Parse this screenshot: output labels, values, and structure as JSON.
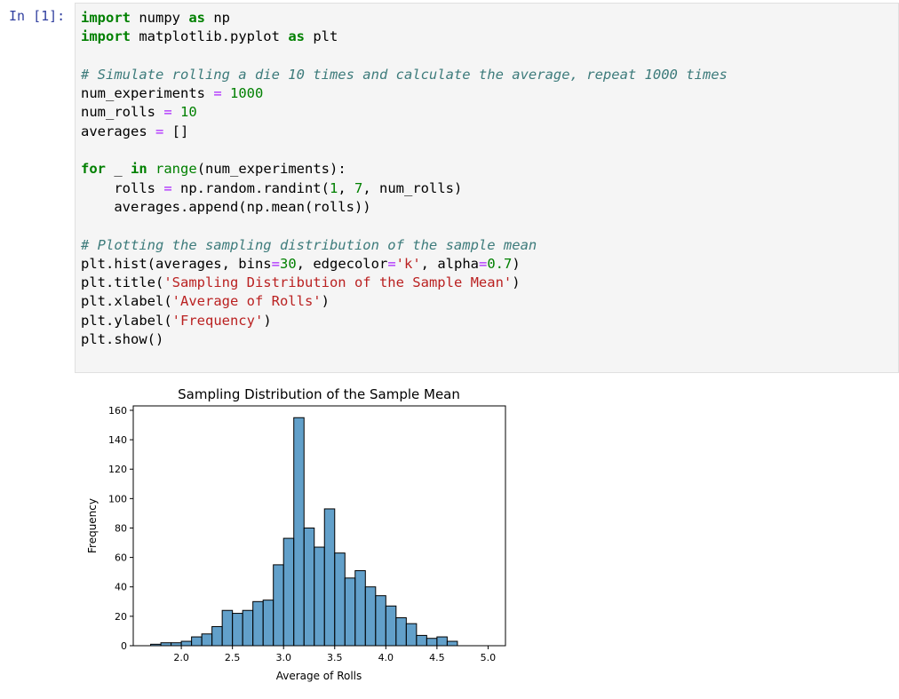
{
  "cell": {
    "prompt": "In [1]:"
  },
  "code": {
    "line1": {
      "kw_import": "import",
      "module": " numpy ",
      "kw_as": "as",
      "alias": " np"
    },
    "line2": {
      "kw_import": "import",
      "module": " matplotlib.pyplot ",
      "kw_as": "as",
      "alias": " plt"
    },
    "line4": {
      "comment": "# Simulate rolling a die 10 times and calculate the average, repeat 1000 times"
    },
    "line5": {
      "name": "num_experiments ",
      "op": "=",
      "value": " 1000"
    },
    "line6": {
      "name": "num_rolls ",
      "op": "=",
      "value": " 10"
    },
    "line7": {
      "name": "averages ",
      "op": "=",
      "rest": " []"
    },
    "line9": {
      "kw_for": "for",
      "var": " _ ",
      "kw_in": "in",
      "sp": " ",
      "builtin": "range",
      "rest": "(num_experiments):"
    },
    "line10": {
      "indent": "    rolls ",
      "op": "=",
      "call": " np.random.randint(",
      "a1": "1",
      "sep1": ", ",
      "a2": "7",
      "rest": ", num_rolls)"
    },
    "line11": {
      "text": "    averages.append(np.mean(rolls))"
    },
    "line13": {
      "comment": "# Plotting the sampling distribution of the sample mean"
    },
    "line14": {
      "p1": "plt.hist(averages, bins",
      "op1": "=",
      "n1": "30",
      "p2": ", edgecolor",
      "op2": "=",
      "s1": "'k'",
      "p3": ", alpha",
      "op3": "=",
      "n2": "0.7",
      "p4": ")"
    },
    "line15": {
      "p1": "plt.title(",
      "s": "'Sampling Distribution of the Sample Mean'",
      "p2": ")"
    },
    "line16": {
      "p1": "plt.xlabel(",
      "s": "'Average of Rolls'",
      "p2": ")"
    },
    "line17": {
      "p1": "plt.ylabel(",
      "s": "'Frequency'",
      "p2": ")"
    },
    "line18": {
      "text": "plt.show()"
    }
  },
  "chart_data": {
    "type": "bar",
    "title": "Sampling Distribution of the Sample Mean",
    "xlabel": "Average of Rolls",
    "ylabel": "Frequency",
    "xlim": [
      1.53,
      5.17
    ],
    "ylim": [
      0,
      163
    ],
    "xticks": [
      "2.0",
      "2.5",
      "3.0",
      "3.5",
      "4.0",
      "4.5",
      "5.0"
    ],
    "xtick_values": [
      2.0,
      2.5,
      3.0,
      3.5,
      4.0,
      4.5,
      5.0
    ],
    "yticks": [
      "0",
      "20",
      "40",
      "60",
      "80",
      "100",
      "120",
      "140",
      "160"
    ],
    "ytick_values": [
      0,
      20,
      40,
      60,
      80,
      100,
      120,
      140,
      160
    ],
    "bin_start": 1.7,
    "bin_width": 0.1,
    "values": [
      1,
      2,
      2,
      3,
      6,
      8,
      13,
      24,
      22,
      24,
      30,
      31,
      55,
      73,
      155,
      80,
      67,
      93,
      63,
      46,
      51,
      40,
      34,
      27,
      19,
      15,
      7,
      5,
      6,
      3
    ],
    "bar_color": "#1f77b4",
    "bar_alpha": 0.7,
    "edge_color": "#000000"
  }
}
